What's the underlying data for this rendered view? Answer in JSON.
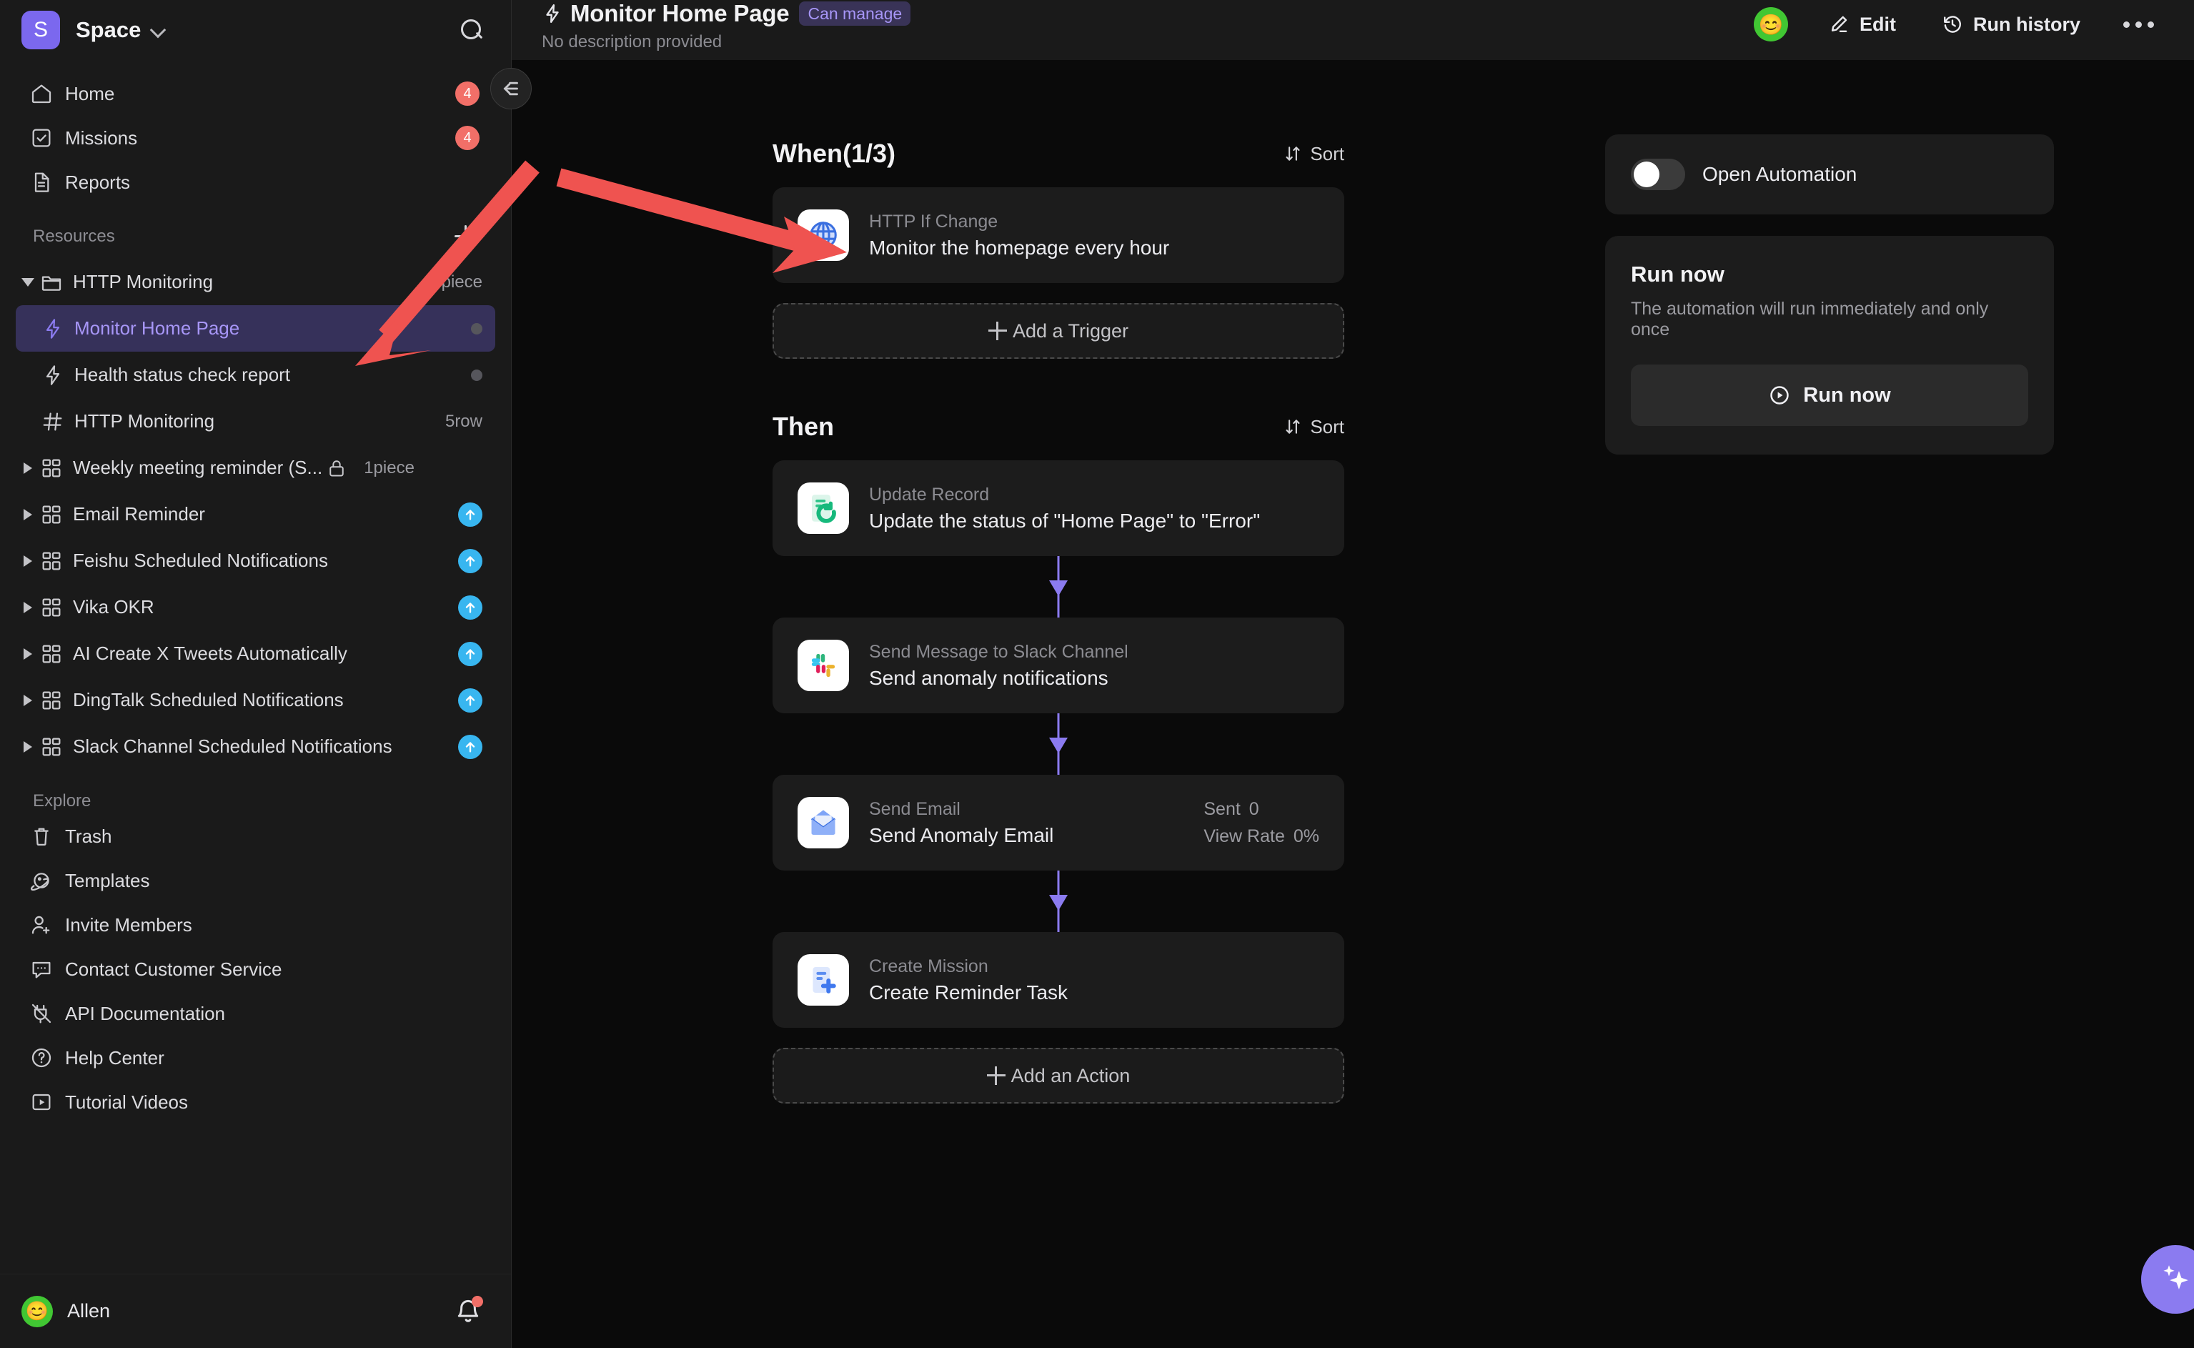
{
  "sidebar": {
    "space": {
      "initial": "S",
      "name": "Space",
      "search_icon": "search-icon"
    },
    "nav": [
      {
        "label": "Home",
        "icon": "home-icon",
        "badge": "4"
      },
      {
        "label": "Missions",
        "icon": "check-square-icon",
        "badge": "4"
      },
      {
        "label": "Reports",
        "icon": "document-icon",
        "badge": ""
      }
    ],
    "resources_header": "Resources",
    "tree": [
      {
        "label": "HTTP Monitoring",
        "icon": "folder-icon",
        "meta": "3piece",
        "expanded": true,
        "indent": 0
      },
      {
        "label": "Monitor Home Page",
        "icon": "bolt-icon",
        "meta": "",
        "active": true,
        "indent": 1
      },
      {
        "label": "Health status check report",
        "icon": "bolt-icon",
        "meta": "",
        "indent": 1
      },
      {
        "label": "HTTP Monitoring",
        "icon": "grid-hash-icon",
        "meta": "5row",
        "indent": 1
      },
      {
        "label": "Weekly meeting reminder (S...",
        "icon": "dashboard-icon",
        "meta": "1piece",
        "locked": true,
        "indent": 0
      },
      {
        "label": "Email Reminder",
        "icon": "dashboard-icon",
        "meta": "",
        "upgrade": true,
        "indent": 0
      },
      {
        "label": "Feishu Scheduled Notifications",
        "icon": "dashboard-icon",
        "meta": "",
        "upgrade": true,
        "indent": 0
      },
      {
        "label": "Vika OKR",
        "icon": "dashboard-icon",
        "meta": "",
        "upgrade": true,
        "indent": 0
      },
      {
        "label": "AI Create X Tweets Automatically",
        "icon": "dashboard-icon",
        "meta": "",
        "upgrade": true,
        "indent": 0
      },
      {
        "label": "DingTalk Scheduled Notifications",
        "icon": "dashboard-icon",
        "meta": "",
        "upgrade": true,
        "indent": 0
      },
      {
        "label": "Slack Channel Scheduled Notifications",
        "icon": "dashboard-icon",
        "meta": "",
        "upgrade": true,
        "indent": 0
      }
    ],
    "explore_header": "Explore",
    "explore": [
      {
        "label": "Trash",
        "icon": "trash-icon"
      },
      {
        "label": "Templates",
        "icon": "planet-icon"
      },
      {
        "label": "Invite Members",
        "icon": "user-plus-icon"
      },
      {
        "label": "Contact Customer Service",
        "icon": "chat-icon"
      },
      {
        "label": "API Documentation",
        "icon": "plug-icon"
      },
      {
        "label": "Help Center",
        "icon": "question-circle-icon"
      },
      {
        "label": "Tutorial Videos",
        "icon": "video-icon"
      }
    ],
    "user": {
      "name": "Allen",
      "avatar_emoji": "😊",
      "bell_icon": "bell-icon",
      "has_notification": true
    }
  },
  "header": {
    "title": "Monitor Home Page",
    "permission_chip": "Can manage",
    "description": "No description provided",
    "avatar_emoji": "😊",
    "edit_label": "Edit",
    "run_history_label": "Run history",
    "more_label": "⋯"
  },
  "flow": {
    "when": {
      "title": "When(1/3)",
      "sort_label": "Sort",
      "triggers": [
        {
          "type": "HTTP If Change",
          "name": "Monitor the homepage every hour",
          "icon": "globe-icon"
        }
      ],
      "add_label": "Add a Trigger"
    },
    "then": {
      "title": "Then",
      "sort_label": "Sort",
      "actions": [
        {
          "type": "Update Record",
          "name": "Update the status of \"Home Page\" to \"Error\"",
          "icon": "update-record-icon"
        },
        {
          "type": "Send Message to Slack Channel",
          "name": "Send anomaly notifications",
          "icon": "slack-icon"
        },
        {
          "type": "Send Email",
          "name": "Send Anomaly Email",
          "icon": "email-icon",
          "stats": [
            {
              "label": "Sent",
              "value": "0"
            },
            {
              "label": "View Rate",
              "value": "0%"
            }
          ]
        },
        {
          "type": "Create Mission",
          "name": "Create Reminder Task",
          "icon": "create-mission-icon"
        }
      ],
      "add_label": "Add an Action"
    }
  },
  "rail": {
    "toggle_label": "Open Automation",
    "toggle_on": false,
    "run_title": "Run now",
    "run_desc": "The automation will run immediately and only once",
    "run_button_label": "Run now"
  },
  "ai_fab": {
    "icon": "sparkles-icon"
  },
  "colors": {
    "accent": "#7b68ee",
    "connector": "#8b7bf0",
    "badge_red": "#f26f68",
    "upgrade_blue": "#38b6f0",
    "annotation_red": "#ef5350",
    "panel_bg": "#1c1c1c",
    "sidebar_bg": "#1a1a1a",
    "canvas_bg": "#0a0a0a"
  }
}
